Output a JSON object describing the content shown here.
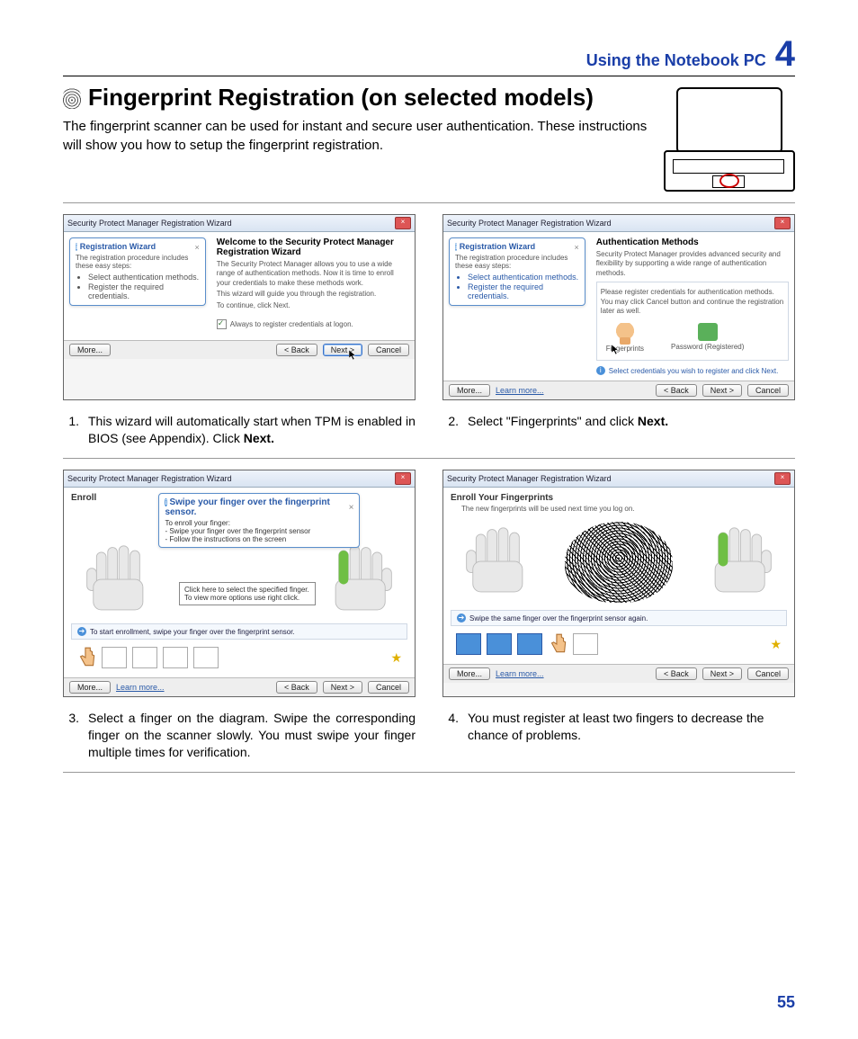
{
  "header": {
    "chapter_title": "Using the Notebook PC",
    "chapter_number": "4"
  },
  "section": {
    "title": "Fingerprint Registration (on selected models)",
    "intro": "The fingerprint scanner can be used for instant and secure user authentication. These instructions will show you how to setup the fingerprint registration."
  },
  "wizard_common": {
    "window_title": "Security Protect Manager Registration Wizard",
    "more_btn": "More...",
    "learn_link": "Learn more...",
    "back_btn": "< Back",
    "next_btn": "Next >",
    "cancel_btn": "Cancel"
  },
  "steps": [
    {
      "num": "1.",
      "text_pre": "This wizard will automatically start when TPM is enabled in BIOS (see  Appendix). Click ",
      "bold": "Next.",
      "callout_title": "Registration Wizard",
      "callout_intro": "The registration procedure includes these easy steps:",
      "callout_items": [
        "Select authentication methods.",
        "Register the required credentials."
      ],
      "right_title": "Welcome to the Security Protect Manager Registration Wizard",
      "right_p1": "The Security Protect Manager allows you to use a wide range of authentication methods. Now it is time to enroll your credentials to make these methods work.",
      "right_p2": "This wizard will guide you through the registration.",
      "right_p3": "To continue, click Next.",
      "check_label": "Always to register credentials at logon."
    },
    {
      "num": "2.",
      "text_pre": "Select \"Fingerprints\" and click ",
      "bold": "Next.",
      "callout_title": "Registration Wizard",
      "callout_intro": "The registration procedure includes these easy steps:",
      "callout_items": [
        "Select authentication methods.",
        "Register the required credentials."
      ],
      "right_title": "Authentication Methods",
      "right_sub": "Security Protect Manager provides advanced security and flexibility by supporting a wide range of authentication methods.",
      "right_instr": "Please register credentials for authentication methods. You may click Cancel button and continue the registration later as well.",
      "icons": {
        "fp": "Fingerprints",
        "pw": "Password (Registered)"
      },
      "select_label": "Select credentials you wish to register and click Next."
    },
    {
      "num": "3.",
      "text_pre": "Select a finger on the diagram. Swipe the corresponding finger on the scanner slowly. You must swipe your finger multiple times for verification.",
      "bold": "",
      "enroll_title_left": "Enroll",
      "callout_title": "Swipe your finger over the fingerprint sensor.",
      "callout_intro": "To enroll your finger:",
      "callout_items": [
        "Swipe your finger over the fingerprint sensor",
        "Follow the instructions on the screen"
      ],
      "tip": "Click here to select the specified finger.\nTo view more options use right click.",
      "info": "To start enrollment, swipe your finger over the fingerprint sensor."
    },
    {
      "num": "4.",
      "text_pre": "You must register at least two fingers to decrease the chance of problems.",
      "bold": "",
      "enroll_title": "Enroll Your Fingerprints",
      "enroll_sub": "The new fingerprints will be used next time you log on.",
      "info": "Swipe the same finger over the fingerprint sensor again."
    }
  ],
  "page_number": "55"
}
